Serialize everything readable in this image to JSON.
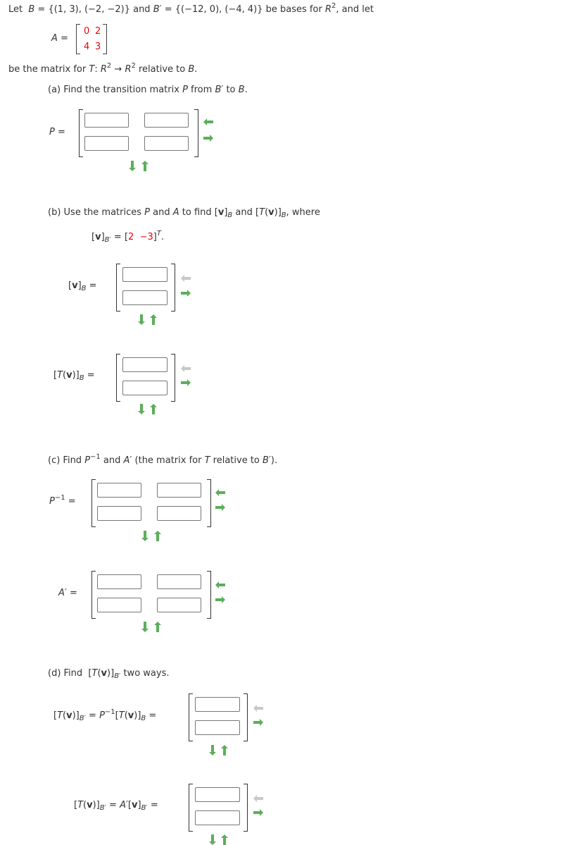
{
  "intro": {
    "line1_let": "Let",
    "B_name": "B",
    "eq": " = ",
    "B_set": "{(1, 3), (−2, −2)}",
    "and": " and ",
    "Bp_name": "B′",
    "Bp_set": "{(−12, 0), (−4, 4)}",
    "be_bases": " be bases for ",
    "R": "R",
    "sq": "2",
    "and_let": ",  and let",
    "A_label": "A",
    "A_matrix": [
      [
        "0",
        "2"
      ],
      [
        "4",
        "3"
      ]
    ],
    "line3_pre": "be the matrix for ",
    "T": "T",
    "colon": ": ",
    "arrow": " → ",
    "line3_post": " relative to ",
    "B_end": "B",
    "period": "."
  },
  "part_a": {
    "prefix": "(a) Find the transition matrix ",
    "P": "P",
    "from": " from ",
    "Bp": "B′",
    "to": " to ",
    "B": "B",
    "end": ".",
    "label": "P ="
  },
  "part_b": {
    "prefix": "(b) Use the matrices ",
    "P": "P",
    "and": " and ",
    "A": "A",
    "to_find": " to find ",
    "and2": " and ",
    "where": ", where",
    "given_values": [
      "2",
      "−3"
    ],
    "T_sup": "T",
    "vB_label_eq": " =",
    "TvB_label_eq": " ="
  },
  "part_c": {
    "prefix": "(c) Find ",
    "P": "P",
    "inv": "−1",
    "and": " and ",
    "Ap": "A′",
    "paren": " (the matrix for ",
    "T": "T",
    "rel": " relative to ",
    "Bp": "B′",
    "end": ").",
    "Pinv_label_eq": " =",
    "Ap_label": "A′ ="
  },
  "part_d": {
    "prefix": "(d) Find ",
    "suffix": " two ways.",
    "eq1_label_mid": " = ",
    "eq_end": " ="
  },
  "arrows": {
    "colors": {
      "active": "#5cae5c",
      "inactive": "#c8c8c8"
    }
  }
}
